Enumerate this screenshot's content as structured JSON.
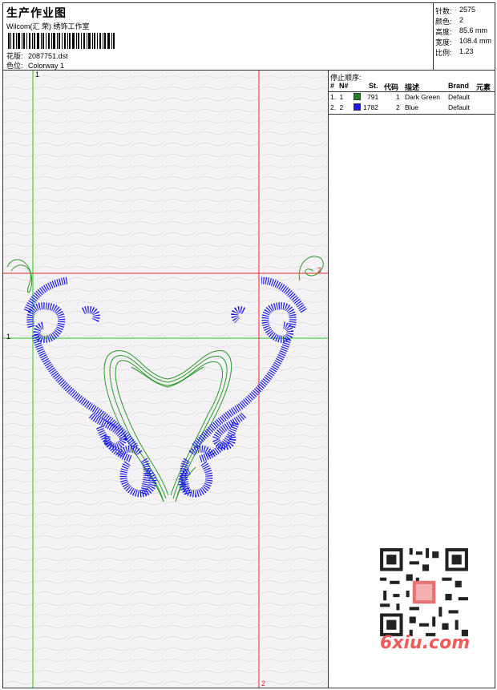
{
  "header": {
    "title": "生产作业图",
    "company": "Wilcom(汇 荣) 绣饰工作室",
    "design_label": "花版:",
    "design_value": "2087751.dst",
    "colorway_label": "色位:",
    "colorway_value": "Colorway 1"
  },
  "stats": [
    {
      "label": "针数:",
      "value": "2575"
    },
    {
      "label": "颜色:",
      "value": "2"
    },
    {
      "label": "高度:",
      "value": "85.6 mm"
    },
    {
      "label": "宽度:",
      "value": "108.4 mm"
    },
    {
      "label": "比例:",
      "value": "1.23"
    }
  ],
  "stop_table": {
    "title": "停止顺序:",
    "headers": [
      "#",
      "N#",
      "St.",
      "代码",
      "描述",
      "Brand",
      "元素"
    ],
    "rows": [
      {
        "num": "1.",
        "n": "1",
        "color": "#1a8a1a",
        "st": "791",
        "code": "1",
        "desc": "Dark Green",
        "brand": "Default"
      },
      {
        "num": "2.",
        "n": "2",
        "color": "#1a1ae6",
        "st": "1782",
        "code": "2",
        "desc": "Blue",
        "brand": "Default"
      }
    ]
  },
  "axes": {
    "v1_top": "1",
    "h1_left": "1",
    "h2_right": "2",
    "v2_bottom": "2"
  },
  "watermark": "6xiu.com",
  "colors": {
    "green_thread": "#2a9a2a",
    "blue_thread": "#1a1ae6",
    "guide_green": "#22cc22",
    "guide_red": "#e62a2a"
  }
}
